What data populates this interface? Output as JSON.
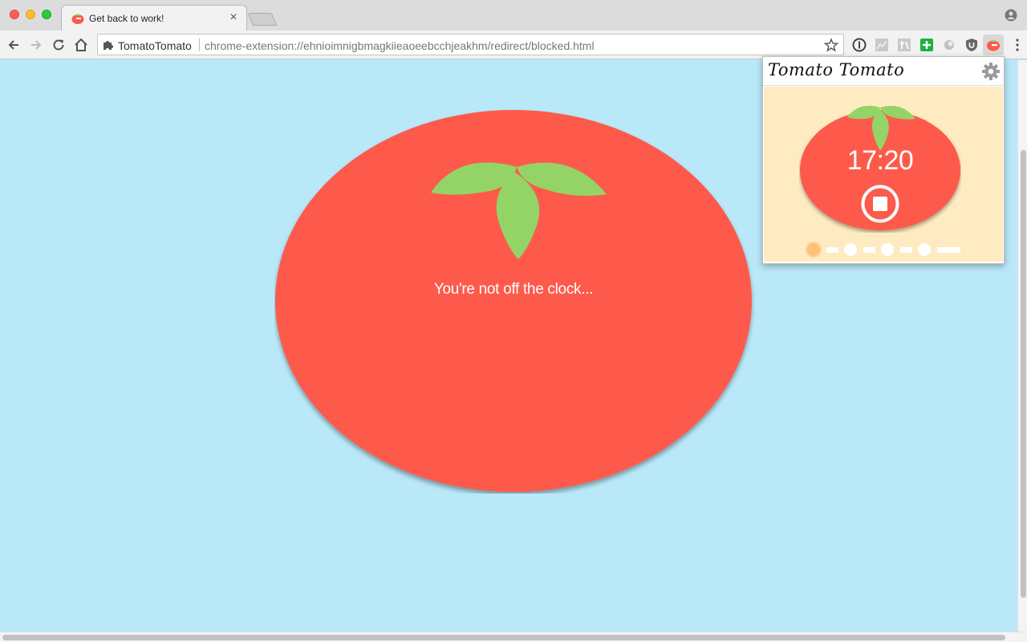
{
  "browser": {
    "tab": {
      "title": "Get back to work!",
      "close_glyph": "×"
    },
    "omnibox": {
      "extension_name": "TomatoTomato",
      "url": "chrome-extension://ehnioimnigbmagkiieaoeebcchjeakhm/redirect/blocked.html"
    },
    "nav_icons": [
      "back-icon",
      "forward-icon",
      "reload-icon",
      "home-icon"
    ],
    "extension_icons": [
      "1password-icon",
      "chart-extension-icon",
      "translate-extension-icon",
      "plus-extension-icon",
      "circle-extension-icon",
      "ublock-icon",
      "tomato-extension-icon"
    ]
  },
  "page": {
    "message": "You're not off the clock..."
  },
  "popup": {
    "title": "Tomato Tomato",
    "timer": "17:20",
    "sessions": {
      "completed": 0,
      "current": 1,
      "total": 4
    }
  },
  "colors": {
    "page_background": "#b9e9f9",
    "tomato_red": "#fd5a4c",
    "leaf_green": "#94d467",
    "popup_background": "#feebc1"
  }
}
